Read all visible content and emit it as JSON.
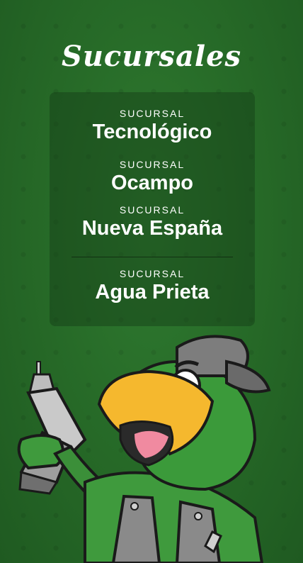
{
  "page": {
    "title": "Sucursales"
  },
  "branches": [
    {
      "caption": "SUCURSAL",
      "name": "Tecnológico"
    },
    {
      "caption": "SUCURSAL",
      "name": "Ocampo"
    },
    {
      "caption": "SUCURSAL",
      "name": "Nueva España"
    },
    {
      "caption": "SUCURSAL",
      "name": "Agua Prieta"
    }
  ],
  "colors": {
    "background": "#2b6f2c",
    "panel": "#1f4f21",
    "text": "#ffffff",
    "beak": "#f5b82e"
  },
  "icons": {
    "mascot": "parrot-mascot-with-drill-icon"
  }
}
